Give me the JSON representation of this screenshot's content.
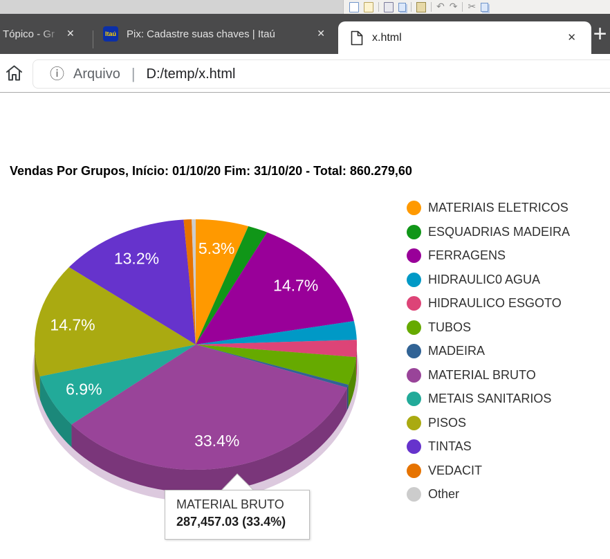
{
  "background_toolbar": {
    "icons": [
      "new-document-icon",
      "open-document-icon",
      "save-icon",
      "copy-icon",
      "paste-icon",
      "undo-icon",
      "redo-icon",
      "cut-icon",
      "clipboard-icon"
    ]
  },
  "browser": {
    "tab_bar": {
      "tabs": [
        {
          "title": "Tópico - Gr",
          "active": false
        },
        {
          "title": "Pix: Cadastre suas chaves | Itaú",
          "active": false,
          "favicon_text": "Itaú"
        },
        {
          "title": "x.html",
          "active": true
        }
      ],
      "close_glyph": "✕",
      "new_tab_glyph": "+"
    },
    "address_bar": {
      "info_glyph": "ⓘ",
      "file_label": "Arquivo",
      "separator": "|",
      "url": "D:/temp/x.html"
    }
  },
  "page": {
    "title": "Vendas Por Grupos, Início: 01/10/20 Fim: 31/10/20 - Total: 860.279,60"
  },
  "chart_data": {
    "type": "pie",
    "is_3d": true,
    "title": "Vendas Por Grupos, Início: 01/10/20 Fim: 31/10/20 - Total: 860.279,60",
    "total": "860.279,60",
    "legend_position": "right",
    "direction": "clockwise",
    "start_angle_deg": 0,
    "slices": [
      {
        "label": "MATERIAIS ELETRICOS",
        "percent": 5.3,
        "color": "#ff9900",
        "label_shown": true
      },
      {
        "label": "ESQUADRIAS MADEIRA",
        "percent": 2.0,
        "color": "#109618",
        "label_shown": false
      },
      {
        "label": "FERRAGENS",
        "percent": 14.7,
        "color": "#990099",
        "label_shown": true
      },
      {
        "label": "HIDRAULIC0 AGUA",
        "percent": 2.4,
        "color": "#0099c6",
        "label_shown": false
      },
      {
        "label": "HIDRAULICO ESGOTO",
        "percent": 2.2,
        "color": "#dd4477",
        "label_shown": false
      },
      {
        "label": "TUBOS",
        "percent": 3.6,
        "color": "#66aa00",
        "label_shown": false
      },
      {
        "label": "MADEIRA",
        "percent": 0.4,
        "color": "#316395",
        "label_shown": false
      },
      {
        "label": "MATERIAL BRUTO",
        "percent": 33.4,
        "color": "#994499",
        "label_shown": true,
        "value_label": "287,457.03"
      },
      {
        "label": "METAIS SANITARIOS",
        "percent": 6.9,
        "color": "#22aa99",
        "label_shown": true
      },
      {
        "label": "PISOS",
        "percent": 14.7,
        "color": "#aaaa11",
        "label_shown": true
      },
      {
        "label": "TINTAS",
        "percent": 13.2,
        "color": "#6633cc",
        "label_shown": true
      },
      {
        "label": "VEDACIT",
        "percent": 0.8,
        "color": "#e67300",
        "label_shown": false
      },
      {
        "label": "Other",
        "percent": 0.4,
        "color": "#cccccc",
        "label_shown": false
      }
    ],
    "tooltip": {
      "slice": "MATERIAL BRUTO",
      "line1": "MATERIAL BRUTO",
      "line2": "287,457.03 (33.4%)"
    }
  }
}
